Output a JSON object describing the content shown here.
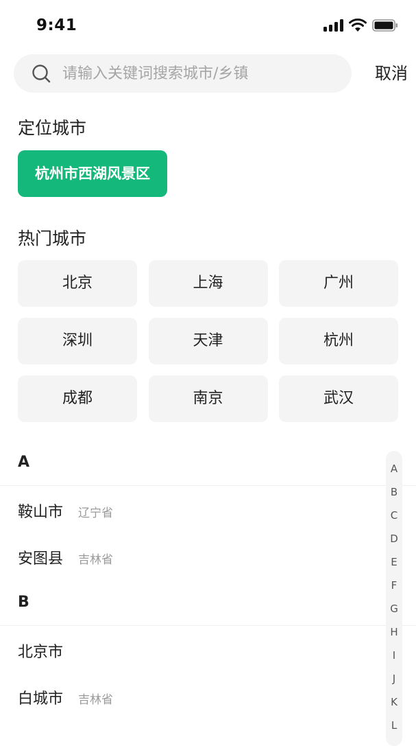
{
  "status_bar": {
    "time": "9:41"
  },
  "search": {
    "placeholder": "请输入关键词搜索城市/乡镇",
    "value": "",
    "cancel_label": "取消"
  },
  "located": {
    "title": "定位城市",
    "city": "杭州市西湖风景区"
  },
  "hot": {
    "title": "热门城市",
    "cities": [
      "北京",
      "上海",
      "广州",
      "深圳",
      "天津",
      "杭州",
      "成都",
      "南京",
      "武汉"
    ]
  },
  "groups": [
    {
      "letter": "A",
      "cities": [
        {
          "name": "鞍山市",
          "province": "辽宁省"
        },
        {
          "name": "安图县",
          "province": "吉林省"
        }
      ]
    },
    {
      "letter": "B",
      "cities": [
        {
          "name": "北京市",
          "province": ""
        },
        {
          "name": "白城市",
          "province": "吉林省"
        }
      ]
    }
  ],
  "index_letters": [
    "A",
    "B",
    "C",
    "D",
    "E",
    "F",
    "G",
    "H",
    "I",
    "J",
    "K",
    "L"
  ],
  "colors": {
    "accent": "#14b87a",
    "chip_bg": "#f4f4f4",
    "text": "#222222",
    "muted": "#9a9a9a"
  },
  "icons": [
    "signal-icon",
    "wifi-icon",
    "battery-icon",
    "search-icon"
  ]
}
